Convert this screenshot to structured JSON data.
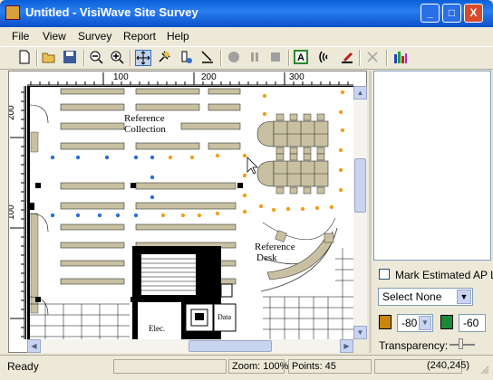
{
  "window": {
    "title": "Untitled - VisiWave Site Survey",
    "controls": {
      "minimize": "_",
      "maximize": "□",
      "close": "X"
    }
  },
  "menu": [
    "File",
    "View",
    "Survey",
    "Report",
    "Help"
  ],
  "toolbar": {
    "icons": [
      "new-file-icon",
      "open-folder-icon",
      "save-icon",
      "zoom-out-icon",
      "zoom-in-icon",
      "pan-icon",
      "pin-icon",
      "survey-point-icon",
      "survey-tool-icon",
      "record-icon",
      "pause-icon",
      "stop-icon",
      "text-label-icon",
      "wifi-signal-icon",
      "pen-icon",
      "disabled-tool-icon",
      "bar-chart-icon"
    ]
  },
  "rulers": {
    "horizontal": [
      "100",
      "200",
      "300"
    ],
    "vertical": [
      "200",
      "100"
    ]
  },
  "floorplan": {
    "labels": {
      "reference_collection_1": "Reference",
      "reference_collection_2": "Collection",
      "reference_desk_1": "Reference",
      "reference_desk_2": "Desk",
      "elec": "Elec.",
      "data": "Data"
    },
    "colors": {
      "blue_point": "#2f6fd6",
      "orange_point": "#f0a020",
      "shelf": "#c8c0a0"
    }
  },
  "side_panel": {
    "mark_estimated_label": "Mark Estimated AP L",
    "select_value": "Select None",
    "color1": "#c8860a",
    "value1": "-80",
    "color2": "#1a8a3a",
    "value2": "-60",
    "transparency_label": "Transparency:"
  },
  "status": {
    "ready": "Ready",
    "zoom": "Zoom: 100%",
    "points": "Points: 45",
    "coords": "(240,245)"
  }
}
